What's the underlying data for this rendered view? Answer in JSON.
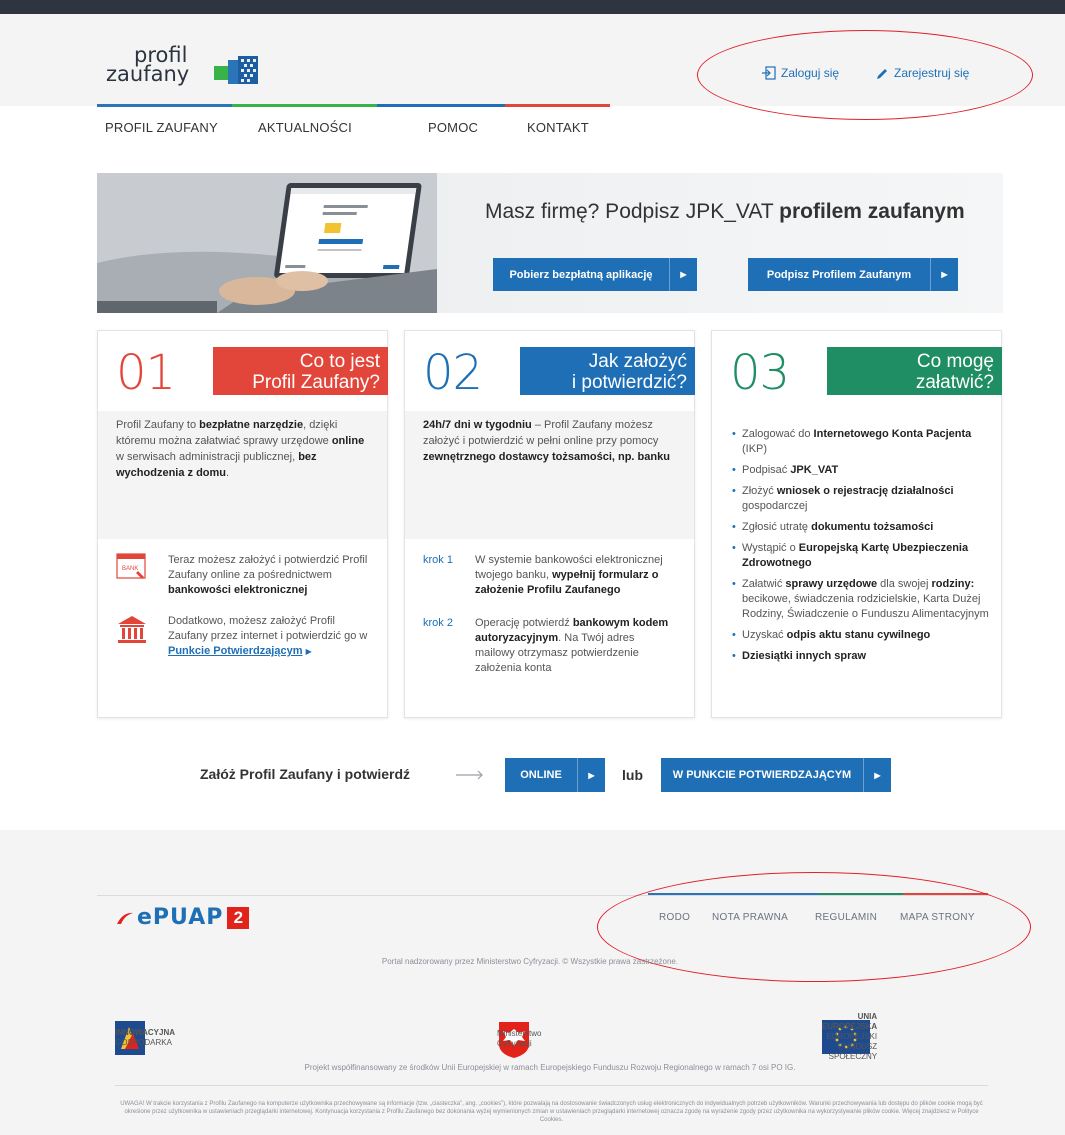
{
  "header": {
    "logo_line1": "profil",
    "logo_line2": "zaufany",
    "login": "Zaloguj się",
    "register": "Zarejestruj się"
  },
  "nav": {
    "items": [
      "PROFIL ZAUFANY",
      "AKTUALNOŚCI",
      "POMOC",
      "KONTAKT"
    ]
  },
  "hero": {
    "title_plain": "Masz firmę? Podpisz JPK_VAT",
    "title_bold": "profilem zaufanym",
    "button1": "Pobierz bezpłatną aplikację",
    "button2": "Podpisz Profilem Zaufanym"
  },
  "card1": {
    "num": "01",
    "tag_line1": "Co to jest",
    "tag_line2": "Profil Zaufany?",
    "intro_1": "Profil Zaufany to ",
    "intro_b1": "bezpłatne narzędzie",
    "intro_2": ", dzięki któremu można załatwiać sprawy urzędowe ",
    "intro_b2": "online",
    "intro_3": " w serwisach administracji publicznej, ",
    "intro_b3": "bez wychodzenia z domu",
    "intro_4": ".",
    "row1_text": "Teraz możesz założyć i potwierdzić Profil Zaufany online za pośrednictwem ",
    "row1_bold": "bankowości elektronicznej",
    "row2_text": "Dodatkowo, możesz założyć Profil Zaufany przez internet i potwierdzić go w ",
    "row2_link": "Punkcie Potwierdzającym",
    "bank_icon_label": "BANK"
  },
  "card2": {
    "num": "02",
    "tag_line1": "Jak założyć",
    "tag_line2": "i potwierdzić?",
    "intro_b1": "24h/7 dni w tygodniu",
    "intro_1": " – Profil Zaufany możesz założyć i potwierdzić w pełni online przy pomocy ",
    "intro_b2": "zewnętrznego dostawcy tożsamości, np. banku",
    "krok1_label": "krok 1",
    "krok1_text": "W systemie bankowości elektronicznej twojego banku, ",
    "krok1_bold": "wypełnij formularz o założenie Profilu Zaufanego",
    "krok2_label": "krok 2",
    "krok2_text": "Operację potwierdź ",
    "krok2_bold": "bankowym kodem autoryzacyjnym",
    "krok2_text2": ". Na Twój adres mailowy otrzymasz potwierdzenie założenia konta"
  },
  "card3": {
    "num": "03",
    "tag_line1": "Co mogę",
    "tag_line2": "załatwić?",
    "items": [
      {
        "pre": "Zalogować do ",
        "bold": "Internetowego Konta Pacjenta",
        "post": " (IKP)"
      },
      {
        "pre": "Podpisać ",
        "bold": "JPK_VAT",
        "post": ""
      },
      {
        "pre": "Złożyć ",
        "bold": "wniosek o rejestrację działalności",
        "post": " gospodarczej"
      },
      {
        "pre": "Zgłosić utratę ",
        "bold": "dokumentu tożsamości",
        "post": ""
      },
      {
        "pre": "Wystąpić o ",
        "bold": "Europejską Kartę Ubezpieczenia Zdrowotnego",
        "post": ""
      },
      {
        "pre": "Załatwić ",
        "bold": "sprawy urzędowe",
        "post": " dla swojej ",
        "bold2": "rodziny:",
        "post2": " becikowe, świadczenia rodzicielskie, Karta Dużej Rodziny, Świadczenie o Funduszu Alimentacyjnym"
      },
      {
        "pre": "Uzyskać ",
        "bold": "odpis aktu stanu cywilnego",
        "post": ""
      },
      {
        "pre": "",
        "bold": "Dziesiątki innych spraw",
        "post": ""
      }
    ]
  },
  "cta": {
    "text": "Załóż Profil Zaufany i potwierdź",
    "online": "ONLINE",
    "or": "lub",
    "punkt": "W PUNKCIE POTWIERDZAJĄCYM"
  },
  "footer": {
    "epuap": "ePUAP",
    "epuap_num": "2",
    "links": [
      "RODO",
      "NOTA PRAWNA",
      "REGULAMIN",
      "MAPA STRONY"
    ],
    "portal": "Portal nadzorowany przez Ministerstwo Cyfryzacji. © Wszystkie prawa zastrzeżone.",
    "partner1_l1": "INNOWACYJNA",
    "partner1_l2": "GOSPODARKA",
    "partner2_l1": "Ministerstwo",
    "partner2_l2": "Cyfryzacji",
    "partner3_l1": "UNIA EUROPEJSKA",
    "partner3_l2": "EUROPEJSKI",
    "partner3_l3": "FUNDUSZ SPOŁECZNY",
    "project": "Projekt współfinansowany ze środków Unii Europejskiej w ramach Europejskiego Funduszu Rozwoju Regionalnego w ramach 7 osi PO IG.",
    "cookies": "UWAGA! W trakcie korzystania z Profilu Zaufanego na komputerze użytkownika przechowywane są informacje (tzw. „ciasteczka”, ang. „cookies”), które pozwalają na dostosowanie świadczonych usług elektronicznych do indywidualnych potrzeb użytkowników. Warunki przechowywania lub dostępu do plików cookie mogą być określone przez użytkownika w ustawieniach przeglądarki internetowej. Kontynuacja korzystania z Profilu Zaufanego bez dokonania wyżej wymienionych zmian w ustawieniach przeglądarki internetowej oznacza zgodę na wyrażenie zgody przez użytkownika na wykorzystywanie plików cookie. Więcej znajdziesz w Polityce Cookies."
  },
  "colors": {
    "blue": "#1e6fb5",
    "red": "#e2463a",
    "green": "#1f8e64",
    "annotation": "#e0202a"
  }
}
